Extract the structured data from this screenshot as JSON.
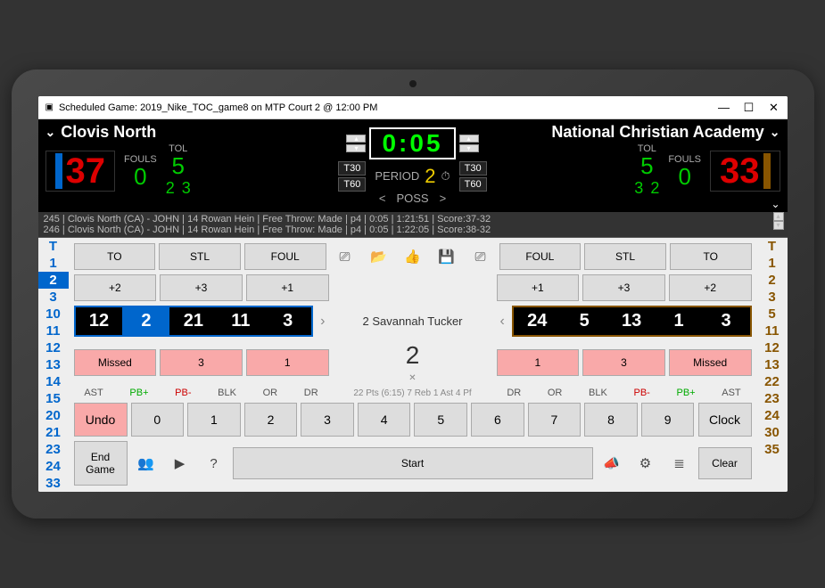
{
  "window": {
    "title": "Scheduled Game: 2019_Nike_TOC_game8 on MTP Court 2 @ 12:00 PM"
  },
  "clock": "0:05",
  "period_label": "PERIOD",
  "period": "2",
  "poss_label": "POSS",
  "timeouts": [
    "T30",
    "T60"
  ],
  "home": {
    "name": "Clovis North",
    "color": "#06c",
    "score": "37",
    "fouls_label": "FOULS",
    "fouls": "0",
    "tol_label": "TOL",
    "tol": "5",
    "bonus": [
      "2",
      "3"
    ],
    "roster": [
      "T",
      "1",
      "2",
      "3",
      "10",
      "11",
      "12",
      "13",
      "14",
      "15",
      "20",
      "21",
      "23",
      "24",
      "33"
    ],
    "oncourt": [
      "12",
      "2",
      "21",
      "11",
      "3"
    ],
    "btns_top": [
      "TO",
      "STL",
      "FOUL"
    ],
    "btns_pts": [
      "+2",
      "+3",
      "+1"
    ],
    "btns_miss": [
      "Missed",
      "3",
      "1"
    ],
    "mini": [
      "AST",
      "PB+",
      "PB-",
      "BLK",
      "OR",
      "DR"
    ],
    "undo": "Undo",
    "endgame": "End Game"
  },
  "away": {
    "name": "National Christian Academy",
    "color": "#850",
    "score": "33",
    "fouls_label": "FOULS",
    "fouls": "0",
    "tol_label": "TOL",
    "tol": "5",
    "bonus": [
      "3",
      "2"
    ],
    "roster": [
      "T",
      "1",
      "2",
      "3",
      "5",
      "11",
      "12",
      "13",
      "22",
      "23",
      "24",
      "30",
      "35"
    ],
    "oncourt": [
      "24",
      "5",
      "13",
      "1",
      "3"
    ],
    "btns_top": [
      "FOUL",
      "STL",
      "TO"
    ],
    "btns_pts": [
      "+1",
      "+3",
      "+2"
    ],
    "btns_miss": [
      "1",
      "3",
      "Missed"
    ],
    "mini": [
      "DR",
      "OR",
      "BLK",
      "PB-",
      "PB+",
      "AST"
    ],
    "clock_btn": "Clock",
    "clear": "Clear"
  },
  "player": {
    "line": "2 Savannah Tucker",
    "num": "2",
    "stats": "22 Pts (6:15) 7 Reb 1 Ast 4 Pf"
  },
  "numpad": [
    "0",
    "1",
    "2",
    "3",
    "4",
    "5",
    "6",
    "7",
    "8",
    "9"
  ],
  "start": "Start",
  "log": [
    "245 | Clovis North (CA) - JOHN | 14 Rowan Hein | Free Throw: Made | p4 | 0:05 | 1:21:51 | Score:37-32",
    "246 | Clovis North (CA) - JOHN | 14 Rowan Hein | Free Throw: Made | p4 | 0:05 | 1:22:05 | Score:38-32"
  ]
}
